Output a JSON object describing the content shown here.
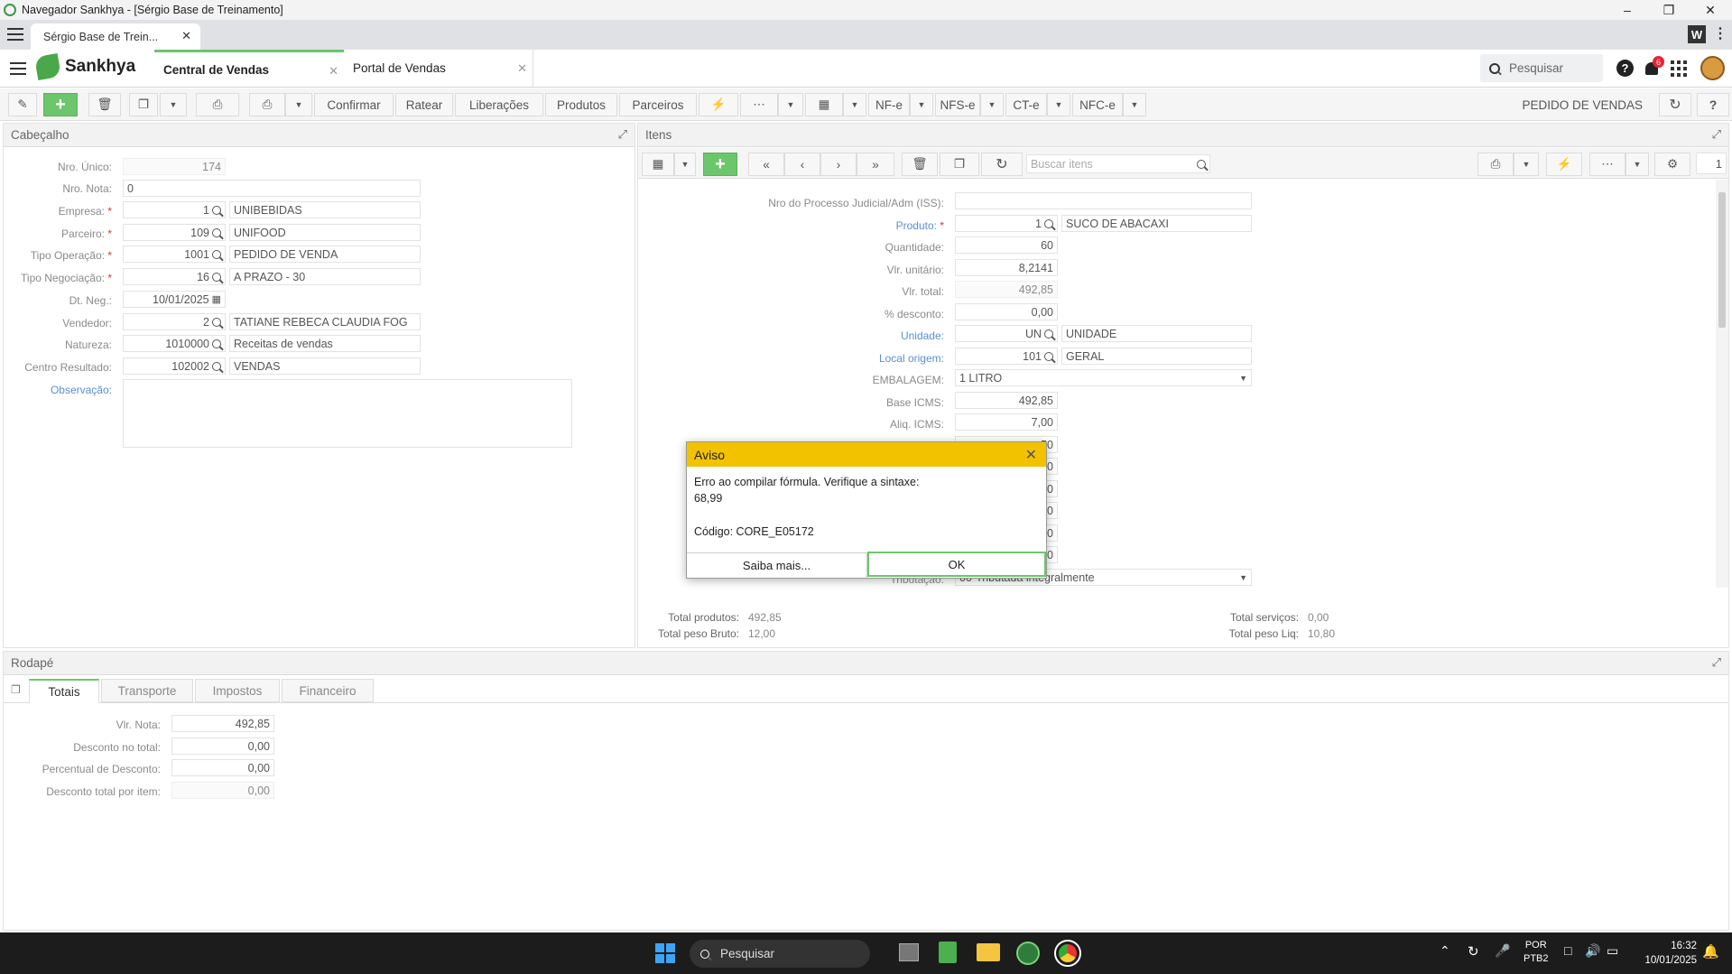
{
  "window": {
    "title": "Navegador Sankhya - [Sérgio Base de Treinamento]"
  },
  "browser_tab": {
    "label": "Sérgio Base de Trein..."
  },
  "app": {
    "brand": "Sankhya",
    "tabs": [
      {
        "label": "Central de Vendas"
      },
      {
        "label": "Portal de Vendas"
      }
    ],
    "search_label": "Pesquisar",
    "notification_count": "6"
  },
  "toolbar": {
    "confirmar": "Confirmar",
    "ratear": "Ratear",
    "liberacoes": "Liberações",
    "produtos": "Produtos",
    "parceiros": "Parceiros",
    "nfe": "NF-e",
    "nfse": "NFS-e",
    "cte": "CT-e",
    "nfce": "NFC-e",
    "screen_title": "PEDIDO DE VENDAS"
  },
  "cabecalho": {
    "title": "Cabeçalho",
    "nro_unico": {
      "label": "Nro. Único:",
      "value": "174"
    },
    "nro_nota": {
      "label": "Nro. Nota:",
      "value": "0"
    },
    "empresa": {
      "label": "Empresa:",
      "code": "1",
      "desc": "UNIBEBIDAS"
    },
    "parceiro": {
      "label": "Parceiro:",
      "code": "109",
      "desc": "UNIFOOD"
    },
    "tipo_operacao": {
      "label": "Tipo Operação:",
      "code": "1001",
      "desc": "PEDIDO DE VENDA"
    },
    "tipo_negociacao": {
      "label": "Tipo Negociação:",
      "code": "16",
      "desc": "A PRAZO - 30"
    },
    "dt_neg": {
      "label": "Dt. Neg.:",
      "value": "10/01/2025"
    },
    "vendedor": {
      "label": "Vendedor:",
      "code": "2",
      "desc": "TATIANE REBECA CLAUDIA FOG"
    },
    "natureza": {
      "label": "Natureza:",
      "code": "1010000",
      "desc": "Receitas de vendas"
    },
    "centro_resultado": {
      "label": "Centro Resultado:",
      "code": "102002",
      "desc": "VENDAS"
    },
    "observacao": {
      "label": "Observação:",
      "value": ""
    }
  },
  "itens": {
    "title": "Itens",
    "search_placeholder": "Buscar itens",
    "page": "1",
    "processo": {
      "label": "Nro do Processo Judicial/Adm (ISS):",
      "value": ""
    },
    "produto": {
      "label": "Produto:",
      "code": "1",
      "desc": "SUCO DE ABACAXI"
    },
    "quantidade": {
      "label": "Quantidade:",
      "value": "60"
    },
    "vlr_unitario": {
      "label": "Vlr. unitário:",
      "value": "8,2141"
    },
    "vlr_total": {
      "label": "Vlr. total:",
      "value": "492,85"
    },
    "desconto": {
      "label": "% desconto:",
      "value": "0,00"
    },
    "unidade": {
      "label": "Unidade:",
      "code": "UN",
      "desc": "UNIDADE"
    },
    "local_origem": {
      "label": "Local origem:",
      "code": "101",
      "desc": "GERAL"
    },
    "embalagem": {
      "label": "EMBALAGEM:",
      "value": "1 LITRO"
    },
    "base_icms": {
      "label": "Base ICMS:",
      "value": "492,85"
    },
    "aliq_icms": {
      "label": "Aliq. ICMS:",
      "value": "7,00"
    },
    "partial_values": [
      "50",
      "0",
      "0",
      "0",
      "0",
      "0"
    ],
    "tributacao": {
      "label": "Tributação:",
      "value": "00-Tributada integralmente"
    },
    "totals": {
      "total_produtos_label": "Total produtos:",
      "total_produtos": "492,85",
      "total_peso_bruto_label": "Total peso Bruto:",
      "total_peso_bruto": "12,00",
      "total_servicos_label": "Total serviços:",
      "total_servicos": "0,00",
      "total_peso_liq_label": "Total peso Liq:",
      "total_peso_liq": "10,80"
    }
  },
  "rodape": {
    "title": "Rodapé",
    "tabs": [
      {
        "label": "Totais"
      },
      {
        "label": "Transporte"
      },
      {
        "label": "Impostos"
      },
      {
        "label": "Financeiro"
      }
    ],
    "vlr_nota": {
      "label": "Vlr. Nota:",
      "value": "492,85"
    },
    "desconto_total": {
      "label": "Desconto no total:",
      "value": "0,00"
    },
    "percentual_desconto": {
      "label": "Percentual de Desconto:",
      "value": "0,00"
    },
    "desconto_item": {
      "label": "Desconto total por item:",
      "value": "0,00"
    }
  },
  "dialog": {
    "title": "Aviso",
    "line1": "Erro ao compilar fórmula. Verifique a sintaxe:",
    "line2": "68,99",
    "code": "Código: CORE_E05172",
    "saiba_mais": "Saiba mais...",
    "ok": "OK"
  },
  "taskbar": {
    "search": "Pesquisar",
    "lang1": "POR",
    "lang2": "PTB2",
    "time": "16:32",
    "date": "10/01/2025"
  },
  "colors": {
    "accent_green": "#6cc66c",
    "dialog_header": "#f2c200",
    "link_blue": "#5b8ed6"
  }
}
